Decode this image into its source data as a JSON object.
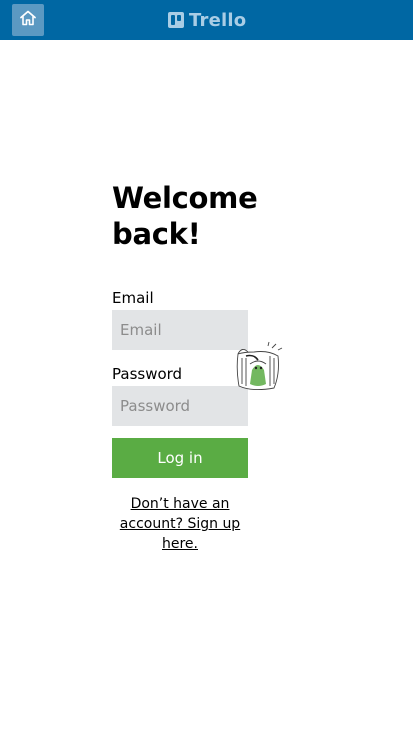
{
  "header": {
    "home_icon": "home-icon",
    "logo_text": "Trello"
  },
  "login": {
    "title": "Welcome back!",
    "email_label": "Email",
    "email_placeholder": "Email",
    "email_value": "",
    "password_label": "Password",
    "password_placeholder": "Password",
    "password_value": "",
    "login_button": "Log in",
    "signup_link": "Don’t have an account? Sign up here."
  },
  "colors": {
    "header_bg": "#0067a3",
    "home_button_bg": "#5b99c2",
    "logo": "#a9cde5",
    "input_bg": "#e2e4e6",
    "login_button_bg": "#5aac44"
  }
}
